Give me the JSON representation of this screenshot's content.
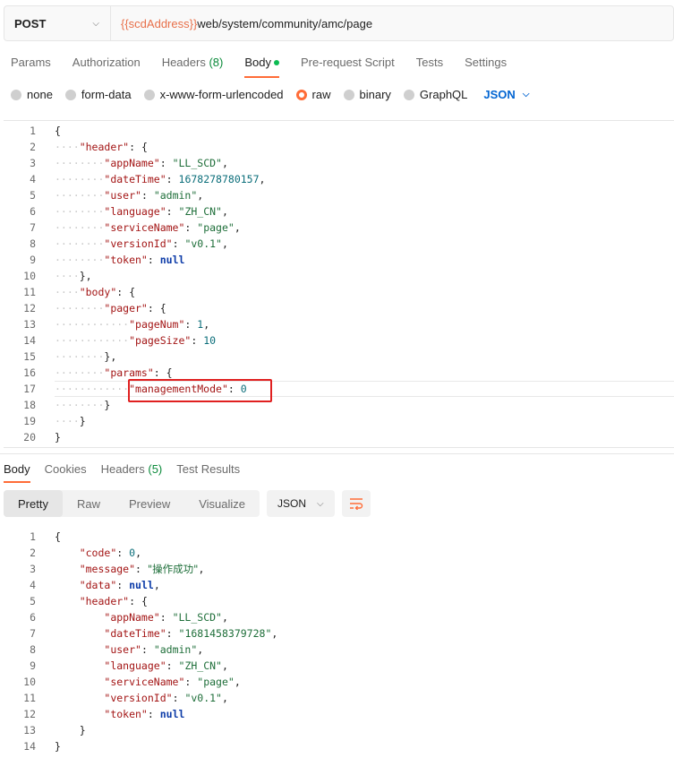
{
  "request": {
    "method": "POST",
    "url_var": "{{scdAddress}}",
    "url_path": "web/system/community/amc/page"
  },
  "request_tabs": [
    {
      "label": "Params"
    },
    {
      "label": "Authorization"
    },
    {
      "label": "Headers",
      "count": "(8)"
    },
    {
      "label": "Body",
      "active": true
    },
    {
      "label": "Pre-request Script"
    },
    {
      "label": "Tests"
    },
    {
      "label": "Settings"
    }
  ],
  "body_types": {
    "options": [
      "none",
      "form-data",
      "x-www-form-urlencoded",
      "raw",
      "binary",
      "GraphQL"
    ],
    "selected": "raw",
    "format": "JSON"
  },
  "request_body_lines": [
    "{",
    "    \"header\": {",
    "        \"appName\": \"LL_SCD\",",
    "        \"dateTime\": 1678278780157,",
    "        \"user\": \"admin\",",
    "        \"language\": \"ZH_CN\",",
    "        \"serviceName\": \"page\",",
    "        \"versionId\": \"v0.1\",",
    "        \"token\": null",
    "    },",
    "    \"body\": {",
    "        \"pager\": {",
    "            \"pageNum\": 1,",
    "            \"pageSize\": 10",
    "        },",
    "        \"params\": {",
    "            \"managementMode\": 0",
    "        }",
    "    }",
    "}"
  ],
  "response_tabs": [
    {
      "label": "Body",
      "active": true
    },
    {
      "label": "Cookies"
    },
    {
      "label": "Headers",
      "count": "(5)"
    },
    {
      "label": "Test Results"
    }
  ],
  "view_modes": [
    "Pretty",
    "Raw",
    "Preview",
    "Visualize"
  ],
  "active_view": "Pretty",
  "response_format": "JSON",
  "response_body_lines": [
    "{",
    "    \"code\": 0,",
    "    \"message\": \"操作成功\",",
    "    \"data\": null,",
    "    \"header\": {",
    "        \"appName\": \"LL_SCD\",",
    "        \"dateTime\": \"1681458379728\",",
    "        \"user\": \"admin\",",
    "        \"language\": \"ZH_CN\",",
    "        \"serviceName\": \"page\",",
    "        \"versionId\": \"v0.1\",",
    "        \"token\": null",
    "    }",
    "}"
  ],
  "colors": {
    "accent": "#ff6c37",
    "url_variable": "#e8704a",
    "json_selector": "#0265d2",
    "highlight_box": "#e02020"
  }
}
